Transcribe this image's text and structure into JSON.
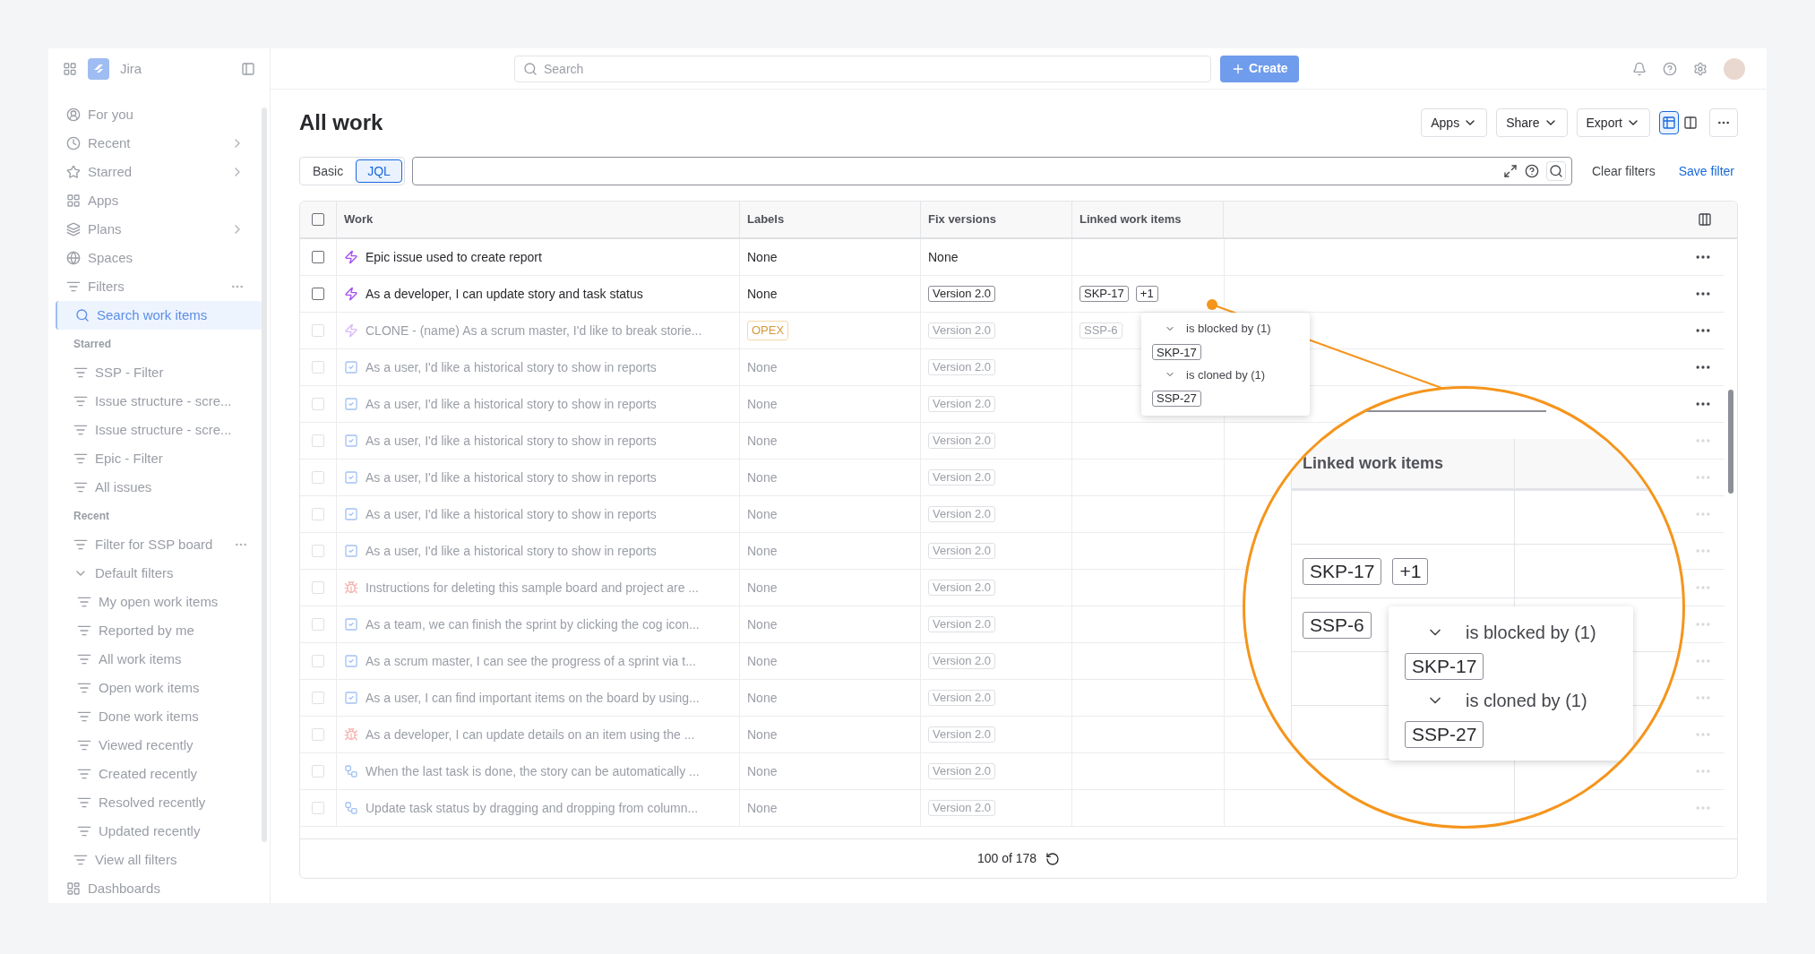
{
  "sidebar": {
    "app_name": "Jira",
    "items": [
      {
        "kind": "nav",
        "label": "For you",
        "selected": false
      },
      {
        "kind": "nav",
        "label": "Recent",
        "selected": false,
        "submenu": true
      },
      {
        "kind": "nav",
        "label": "Starred",
        "selected": false,
        "submenu": true
      },
      {
        "kind": "nav",
        "label": "Apps",
        "selected": false
      },
      {
        "kind": "nav",
        "label": "Plans",
        "selected": false,
        "submenu": true
      },
      {
        "kind": "nav",
        "label": "Spaces",
        "selected": false
      },
      {
        "kind": "nav",
        "label": "Filters",
        "selected": false,
        "more_menu": true
      },
      {
        "kind": "search",
        "label": "Search work items",
        "selected": true
      },
      {
        "kind": "heading",
        "label": "Starred"
      },
      {
        "kind": "filter",
        "label": "SSP - Filter",
        "selected": false
      },
      {
        "kind": "filter",
        "label": "Issue structure - scre...",
        "selected": false
      },
      {
        "kind": "filter",
        "label": "Issue structure - scre...",
        "selected": false
      },
      {
        "kind": "filter",
        "label": "Epic - Filter",
        "selected": false
      },
      {
        "kind": "filter",
        "label": "All issues",
        "selected": false
      },
      {
        "kind": "heading",
        "label": "Recent"
      },
      {
        "kind": "filter",
        "label": "Filter for SSP board",
        "selected": false,
        "more_menu": true
      },
      {
        "kind": "group",
        "label": "Default filters",
        "expanded": true,
        "children": [
          {
            "label": "My open work items",
            "selected": false
          },
          {
            "label": "Reported by me",
            "selected": false
          },
          {
            "label": "All work items",
            "selected": false
          },
          {
            "label": "Open work items",
            "selected": false
          },
          {
            "label": "Done work items",
            "selected": false
          },
          {
            "label": "Viewed recently",
            "selected": false
          },
          {
            "label": "Created recently",
            "selected": false
          },
          {
            "label": "Resolved recently",
            "selected": false
          },
          {
            "label": "Updated recently",
            "selected": false
          }
        ]
      },
      {
        "kind": "filter",
        "label": "View all filters",
        "selected": false
      },
      {
        "kind": "dash",
        "label": "Dashboards",
        "selected": false
      }
    ]
  },
  "header": {
    "search_placeholder": "Search",
    "create_label": "Create"
  },
  "page": {
    "title": "All work",
    "actions": [
      "Apps",
      "Share",
      "Export"
    ],
    "view_modes": [
      {
        "selected": true
      },
      {
        "selected": false
      }
    ]
  },
  "query": {
    "modes": [
      {
        "label": "Basic",
        "selected": false
      },
      {
        "label": "JQL",
        "selected": true
      }
    ],
    "clear_label": "Clear filters",
    "save_label": "Save filter"
  },
  "table": {
    "select_all_checked": false,
    "columns": [
      "Work",
      "Labels",
      "Fix versions",
      "Linked work items"
    ],
    "rows": [
      {
        "kind": "epic",
        "highlighted": true,
        "checked": false,
        "title": "Epic issue used to create report",
        "labels": {
          "kind": "text",
          "text": "None"
        },
        "fix_version": {
          "kind": "text",
          "text": "None"
        }
      },
      {
        "kind": "epic",
        "highlighted": true,
        "checked": false,
        "title": "As a developer, I can update story and task status",
        "labels": {
          "kind": "text",
          "text": "None"
        },
        "fix_version": {
          "kind": "tag",
          "text": "Version 2.0"
        },
        "linked": [
          "SKP-17",
          "+1"
        ]
      },
      {
        "kind": "epic",
        "highlighted": false,
        "checked": false,
        "title": "CLONE - (name) As a scrum master, I'd like to break storie...",
        "labels": {
          "kind": "tag",
          "text": "OPEX"
        },
        "fix_version": {
          "kind": "tag",
          "text": "Version 2.0"
        },
        "linked": [
          "SSP-6"
        ]
      },
      {
        "kind": "story",
        "highlighted": false,
        "checked": false,
        "title": "As a user, I'd like a historical story to show in reports",
        "labels": {
          "kind": "text",
          "text": "None"
        },
        "fix_version": {
          "kind": "tag",
          "text": "Version 2.0"
        }
      },
      {
        "kind": "story",
        "highlighted": false,
        "checked": false,
        "title": "As a user, I'd like a historical story to show in reports",
        "labels": {
          "kind": "text",
          "text": "None"
        },
        "fix_version": {
          "kind": "tag",
          "text": "Version 2.0"
        }
      },
      {
        "kind": "story",
        "highlighted": false,
        "checked": false,
        "title": "As a user, I'd like a historical story to show in reports",
        "labels": {
          "kind": "text",
          "text": "None"
        },
        "fix_version": {
          "kind": "tag",
          "text": "Version 2.0"
        }
      },
      {
        "kind": "story",
        "highlighted": false,
        "checked": false,
        "title": "As a user, I'd like a historical story to show in reports",
        "labels": {
          "kind": "text",
          "text": "None"
        },
        "fix_version": {
          "kind": "tag",
          "text": "Version 2.0"
        }
      },
      {
        "kind": "story",
        "highlighted": false,
        "checked": false,
        "title": "As a user, I'd like a historical story to show in reports",
        "labels": {
          "kind": "text",
          "text": "None"
        },
        "fix_version": {
          "kind": "tag",
          "text": "Version 2.0"
        }
      },
      {
        "kind": "story",
        "highlighted": false,
        "checked": false,
        "title": "As a user, I'd like a historical story to show in reports",
        "labels": {
          "kind": "text",
          "text": "None"
        },
        "fix_version": {
          "kind": "tag",
          "text": "Version 2.0"
        }
      },
      {
        "kind": "bug",
        "highlighted": false,
        "checked": false,
        "title": "Instructions for deleting this sample board and project are ...",
        "labels": {
          "kind": "text",
          "text": "None"
        },
        "fix_version": {
          "kind": "tag",
          "text": "Version 2.0"
        }
      },
      {
        "kind": "story",
        "highlighted": false,
        "checked": false,
        "title": "As a team, we can finish the sprint by clicking the cog icon...",
        "labels": {
          "kind": "text",
          "text": "None"
        },
        "fix_version": {
          "kind": "tag",
          "text": "Version 2.0"
        }
      },
      {
        "kind": "story",
        "highlighted": false,
        "checked": false,
        "title": "As a scrum master, I can see the progress of a sprint via t...",
        "labels": {
          "kind": "text",
          "text": "None"
        },
        "fix_version": {
          "kind": "tag",
          "text": "Version 2.0"
        }
      },
      {
        "kind": "story",
        "highlighted": false,
        "checked": false,
        "title": "As a user, I can find important items on the board by using...",
        "labels": {
          "kind": "text",
          "text": "None"
        },
        "fix_version": {
          "kind": "tag",
          "text": "Version 2.0"
        }
      },
      {
        "kind": "bug",
        "highlighted": false,
        "checked": false,
        "title": "As a developer, I can update details on an item using the ...",
        "labels": {
          "kind": "text",
          "text": "None"
        },
        "fix_version": {
          "kind": "tag",
          "text": "Version 2.0"
        }
      },
      {
        "kind": "subtask",
        "highlighted": false,
        "checked": false,
        "title": "When the last task is done, the story can be automatically ...",
        "labels": {
          "kind": "text",
          "text": "None"
        },
        "fix_version": {
          "kind": "tag",
          "text": "Version 2.0"
        }
      },
      {
        "kind": "subtask",
        "highlighted": false,
        "checked": false,
        "title": "Update task status by dragging and dropping from column...",
        "labels": {
          "kind": "text",
          "text": "None"
        },
        "fix_version": {
          "kind": "tag",
          "text": "Version 2.0"
        }
      }
    ],
    "popup": {
      "groups": [
        {
          "label": "is blocked by (1)",
          "expanded": true,
          "items": [
            "SKP-17"
          ]
        },
        {
          "label": "is cloned by (1)",
          "expanded": true,
          "items": [
            "SSP-27"
          ]
        }
      ]
    },
    "footer": "100 of 178"
  },
  "magnifier": {
    "column": "Linked work items",
    "rows": [
      {
        "links": [
          "SKP-17",
          "+1"
        ]
      },
      {
        "links": [
          "SSP-6"
        ]
      }
    ],
    "popup": {
      "groups": [
        {
          "label": "is blocked by (1)",
          "expanded": true,
          "items": [
            "SKP-17"
          ]
        },
        {
          "label": "is cloned by (1)",
          "expanded": true,
          "items": [
            "SSP-27"
          ]
        }
      ]
    }
  }
}
